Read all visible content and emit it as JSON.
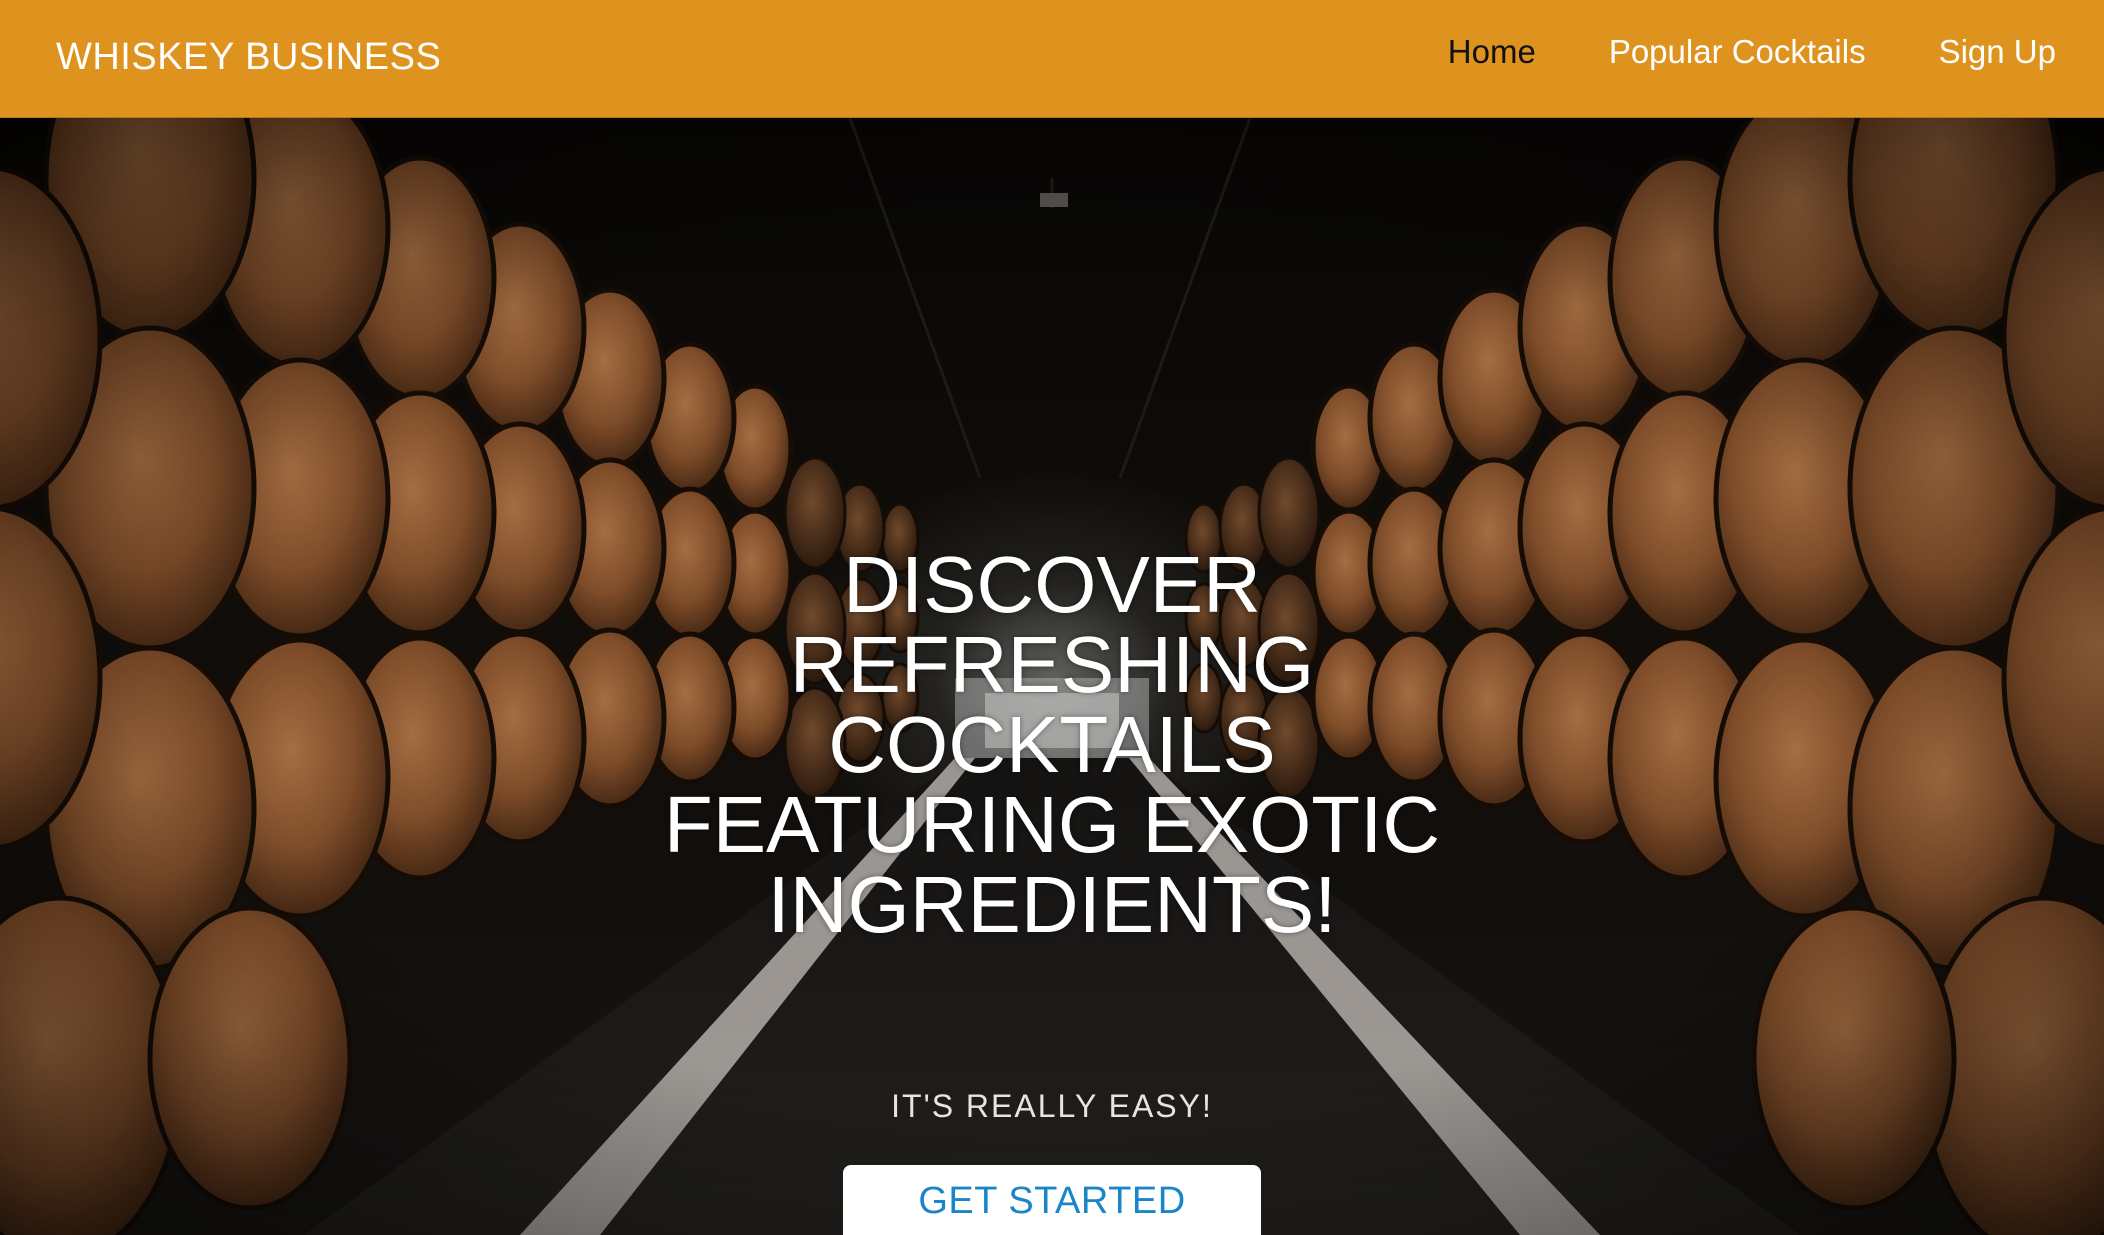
{
  "nav": {
    "brand": "WHISKEY BUSINESS",
    "links": [
      "Home",
      "Popular Cocktails",
      "Sign Up"
    ],
    "active": "Home",
    "background_color": "#df931f"
  },
  "hero": {
    "background_image": "whiskey-barrel-cellar",
    "title": "DISCOVER REFRESHING COCKTAILS FEATURING EXOTIC INGREDIENTS!",
    "subtitle": "IT'S REALLY EASY!",
    "cta_label": "GET STARTED",
    "cta_color": "#1a86c8"
  }
}
